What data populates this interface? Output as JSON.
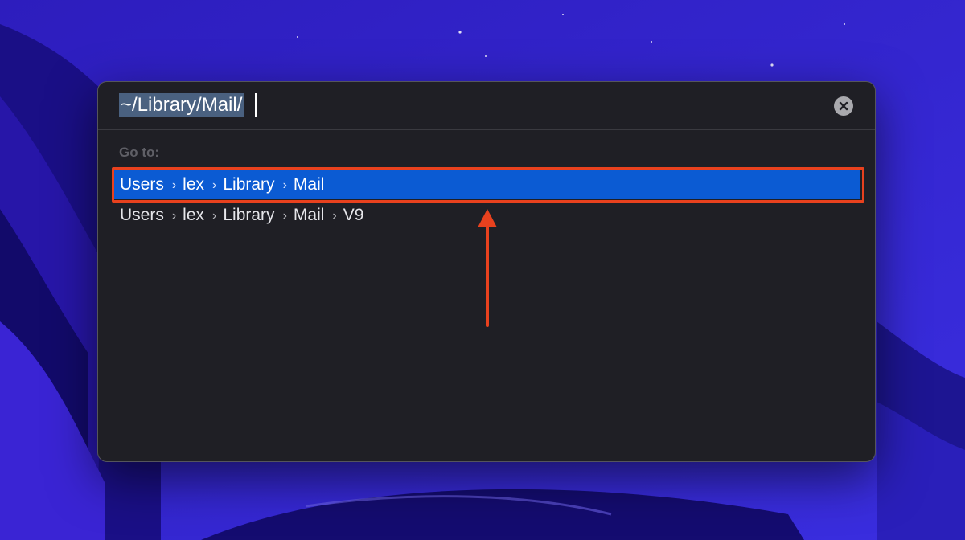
{
  "dialog": {
    "path_value": "~/Library/Mail/",
    "clear_icon": "clear-x-icon",
    "goto_label": "Go to:",
    "results": [
      {
        "segments": [
          "Users",
          "lex",
          "Library",
          "Mail"
        ],
        "selected": true
      },
      {
        "segments": [
          "Users",
          "lex",
          "Library",
          "Mail",
          "V9"
        ],
        "selected": false
      }
    ]
  },
  "annotation": {
    "highlight_color": "#e8411e",
    "arrow_icon": "up-arrow-annotation"
  },
  "colors": {
    "selection": "#0b5bd3",
    "dialog_bg": "#1f1f25",
    "wallpaper": "#2a1fb0"
  }
}
